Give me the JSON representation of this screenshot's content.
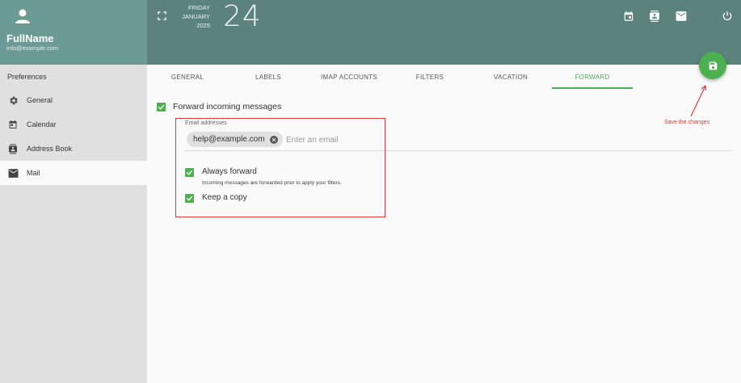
{
  "user": {
    "name": "FullName",
    "email": "info@example.com"
  },
  "sidebar": {
    "title": "Preferences",
    "items": [
      {
        "label": "General",
        "icon": "gear-icon"
      },
      {
        "label": "Calendar",
        "icon": "calendar-icon"
      },
      {
        "label": "Address Book",
        "icon": "contact-card-icon"
      },
      {
        "label": "Mail",
        "icon": "mail-icon",
        "active": true
      }
    ]
  },
  "header": {
    "weekday": "FRIDAY",
    "month": "JANUARY",
    "year": "2025",
    "day": "24",
    "icons": [
      "calendar-icon",
      "contact-card-icon",
      "mail-icon",
      "power-icon"
    ]
  },
  "tabs": [
    {
      "label": "GENERAL"
    },
    {
      "label": "LABELS"
    },
    {
      "label": "IMAP ACCOUNTS"
    },
    {
      "label": "FILTERS"
    },
    {
      "label": "VACATION"
    },
    {
      "label": "FORWARD",
      "active": true
    }
  ],
  "forward": {
    "enabled_label": "Forward incoming messages",
    "enabled": true,
    "email_label": "Email addresses",
    "emails": [
      "help@example.com"
    ],
    "email_placeholder": "Enter an email",
    "always_label": "Always forward",
    "always_checked": true,
    "always_hint": "Incoming messages are forwarded prior to apply your filters.",
    "copy_label": "Keep a copy",
    "copy_checked": true
  },
  "annotation": {
    "save_note": "Save the changes",
    "color": "#e53935"
  },
  "colors": {
    "accent": "#4caf50",
    "header": "#5b827d",
    "user_box": "#6c9a94"
  }
}
